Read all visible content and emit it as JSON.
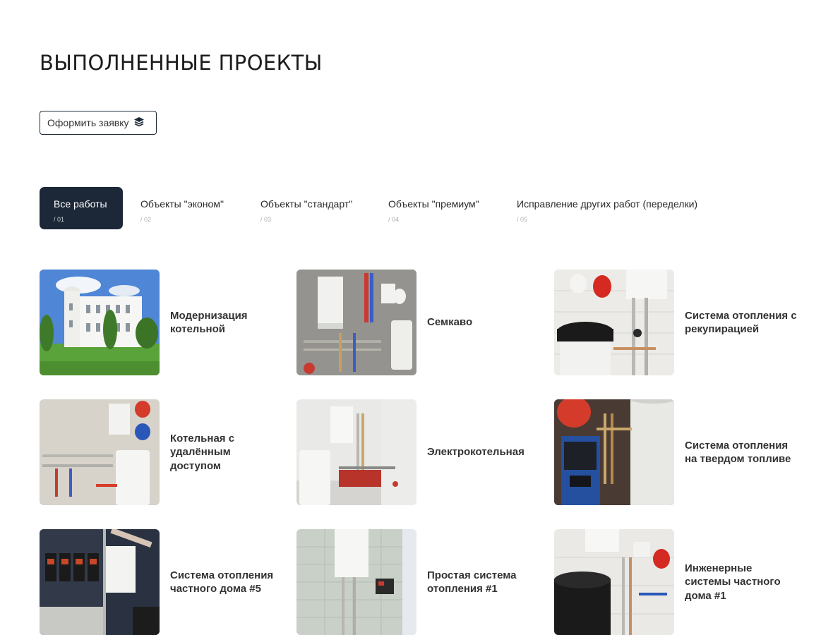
{
  "page": {
    "title": "ВЫПОЛНЕННЫЕ ПРОЕКТЫ"
  },
  "cta": {
    "label": "Оформить заявку",
    "icon": "layers-icon"
  },
  "tabs": [
    {
      "label": "Все работы",
      "num": "/ 01",
      "active": true
    },
    {
      "label": "Объекты \"эконом\"",
      "num": "/ 02",
      "active": false
    },
    {
      "label": "Объекты \"стандарт\"",
      "num": "/ 03",
      "active": false
    },
    {
      "label": "Объекты \"премиум\"",
      "num": "/ 04",
      "active": false
    },
    {
      "label": "Исправление других работ (переделки)",
      "num": "/ 05",
      "active": false
    }
  ],
  "projects": [
    {
      "title": "Модернизация котельной"
    },
    {
      "title": "Семкаво"
    },
    {
      "title": "Система отопления с рекупирацией"
    },
    {
      "title": "Котельная с удалённым доступом"
    },
    {
      "title": "Электрокотельная"
    },
    {
      "title": "Система отопления на твердом топливе"
    },
    {
      "title": "Система отопления частного дома #5"
    },
    {
      "title": "Простая система отопления #1"
    },
    {
      "title": "Инженерные системы частного дома #1"
    }
  ],
  "colors": {
    "accent": "#1c2838",
    "text": "#333333",
    "muted": "#b0b0b0"
  }
}
